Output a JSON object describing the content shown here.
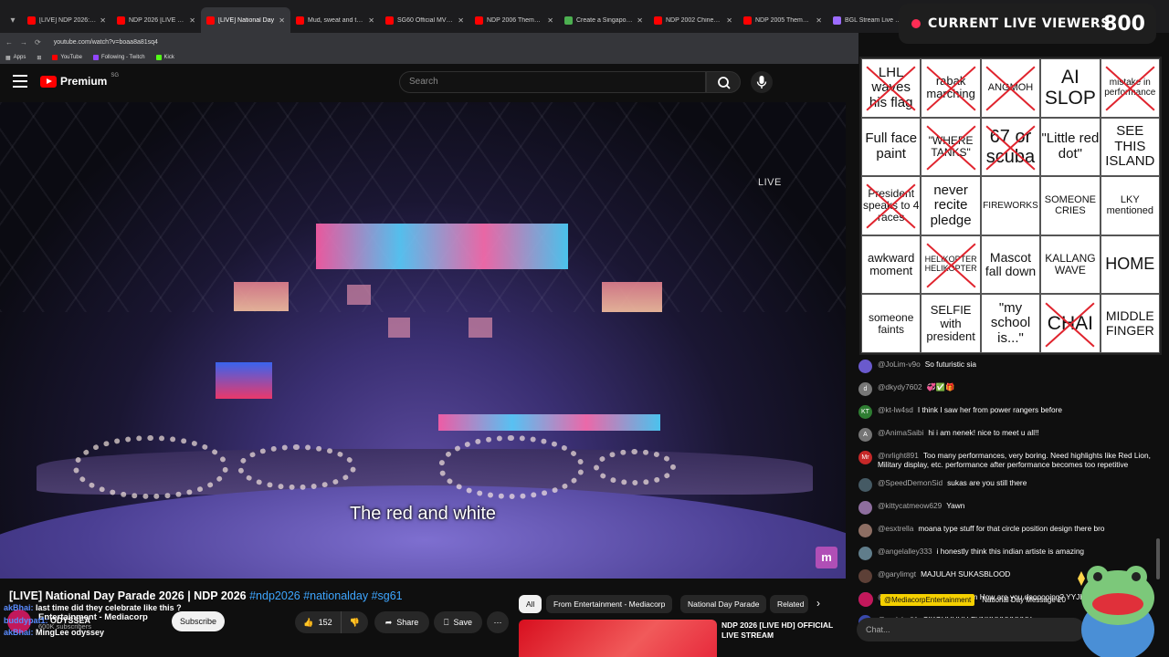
{
  "browser": {
    "tabs": [
      {
        "title": "[LIVE] NDP 2026: Singa",
        "active": false,
        "fav": "yt"
      },
      {
        "title": "NDP 2026 [LIVE HD] OF",
        "active": false,
        "fav": "yt"
      },
      {
        "title": "[LIVE] National Day",
        "active": true,
        "fav": "yt"
      },
      {
        "title": "Mud, sweat and tears",
        "active": false,
        "fav": "yt"
      },
      {
        "title": "SG60 Official MV (Koala",
        "active": false,
        "fav": "yt"
      },
      {
        "title": "NDP 2006 Theme Song",
        "active": false,
        "fav": "yt"
      },
      {
        "title": "Create a Singapore ND",
        "active": false,
        "fav": "doc"
      },
      {
        "title": "NDP 2002 Chinese The",
        "active": false,
        "fav": "yt"
      },
      {
        "title": "NDP 2005 Theme Song",
        "active": false,
        "fav": "yt"
      },
      {
        "title": "BGL Stream Live Views",
        "active": false,
        "fav": "alt"
      }
    ],
    "url": "youtube.com/watch?v=boaa8a81sq4",
    "bookmarks": [
      "Apps",
      "YouTube",
      "Following - Twitch",
      "Kick"
    ]
  },
  "youtube": {
    "logo_text": "Premium",
    "logo_country": "SG",
    "search_placeholder": "Search"
  },
  "video": {
    "live_label": "LIVE",
    "caption": "The red and white",
    "title_plain": "[LIVE] National Day Parade 2026 | NDP 2026 ",
    "hashtags": "#ndp2026 #nationalday #sg61",
    "channel_name": "Entertainment - Mediacorp",
    "subscribers": "600K subscribers",
    "subscribe_label": "Subscribe",
    "likes": "152",
    "share_label": "Share",
    "save_label": "Save"
  },
  "overlay_chat": [
    {
      "user": "akBhai:",
      "text": "last time did they celebrate like this ?"
    },
    {
      "user": "buddypat1:",
      "text": "ODYSSEA"
    },
    {
      "user": "akBhai:",
      "text": "MingLee odyssey"
    }
  ],
  "recommendations": {
    "chips": [
      "All",
      "From Entertainment - Mediacorp",
      "National Day Parade",
      "Related"
    ],
    "first_title": "NDP 2026 [LIVE HD] OFFICIAL LIVE STREAM"
  },
  "viewers": {
    "label": "CURRENT LIVE VIEWERS",
    "count": "800"
  },
  "bingo": [
    {
      "text": "LHL waves his flag",
      "crossed": true,
      "size": 15
    },
    {
      "text": "rabak marching",
      "crossed": true,
      "size": 13
    },
    {
      "text": "ANGMOH",
      "crossed": true,
      "size": 11
    },
    {
      "text": "AI SLOP",
      "crossed": false,
      "size": 21
    },
    {
      "text": "mistake in performance",
      "crossed": true,
      "size": 10
    },
    {
      "text": "Full face paint",
      "crossed": false,
      "size": 15
    },
    {
      "text": "\"WHERE TANKS\"",
      "crossed": true,
      "size": 12
    },
    {
      "text": "67 or scuba",
      "crossed": true,
      "size": 20
    },
    {
      "text": "\"Little red dot\"",
      "crossed": false,
      "size": 15
    },
    {
      "text": "SEE THIS ISLAND",
      "crossed": false,
      "size": 15
    },
    {
      "text": "President speaks to 4 races",
      "crossed": true,
      "size": 12
    },
    {
      "text": "never recite pledge",
      "crossed": false,
      "size": 15
    },
    {
      "text": "FIREWORKS",
      "crossed": false,
      "size": 10
    },
    {
      "text": "SOMEONE CRIES",
      "crossed": false,
      "size": 11
    },
    {
      "text": "LKY mentioned",
      "crossed": false,
      "size": 11
    },
    {
      "text": "awkward moment",
      "crossed": false,
      "size": 13
    },
    {
      "text": "HELIKOPTER HELIKOPTER",
      "crossed": true,
      "size": 9
    },
    {
      "text": "Mascot fall down",
      "crossed": false,
      "size": 14
    },
    {
      "text": "KALLANG WAVE",
      "crossed": false,
      "size": 12
    },
    {
      "text": "HOME",
      "crossed": false,
      "size": 18
    },
    {
      "text": "someone faints",
      "crossed": false,
      "size": 12
    },
    {
      "text": "SELFIE with president",
      "crossed": false,
      "size": 13
    },
    {
      "text": "\"my school is...\"",
      "crossed": false,
      "size": 15
    },
    {
      "text": "CHAI",
      "crossed": true,
      "size": 21
    },
    {
      "text": "MIDDLE FINGER",
      "crossed": false,
      "size": 14
    }
  ],
  "chat": [
    {
      "user": "@JoLim-v9o",
      "text": "So futuristic sia",
      "color": "#6a5acd",
      "initial": ""
    },
    {
      "user": "@dkydy7602",
      "text": "💞✅🎁",
      "color": "#777777",
      "initial": "d"
    },
    {
      "user": "@kt-lw4sd",
      "text": "I think I saw her from power rangers before",
      "color": "#2e7d32",
      "initial": "KT"
    },
    {
      "user": "@AnimaSaibi",
      "text": "hi i am nenek! nice to meet u all!!",
      "color": "#757575",
      "initial": "A"
    },
    {
      "user": "@nrlight891",
      "text": "Too many performances, very boring. Need highlights like Red Lion, Military display, etc. performance after performance becomes too repetitive",
      "color": "#c62828",
      "initial": "Mr"
    },
    {
      "user": "@SpeedDemonSid",
      "text": "sukas are you still there",
      "color": "#455a64",
      "initial": ""
    },
    {
      "user": "@kittycatmeow629",
      "text": "Yawn",
      "color": "#8e6e9e",
      "initial": ""
    },
    {
      "user": "@esxtrella",
      "text": "moana type stuff for that circle position design there bro",
      "color": "#8d6e63",
      "initial": ""
    },
    {
      "user": "@angelalley333",
      "text": "i honestly think this indian artiste is amazing",
      "color": "#607d8b",
      "initial": ""
    },
    {
      "user": "@garylimgt",
      "text": "MAJULAH SUKASBLOOD",
      "color": "#5d4037",
      "initial": ""
    },
    {
      "user": "@lilbearbear4133",
      "text": "@clairelim How are you doooooing? YYJHEART",
      "color": "#7b5fa0",
      "initial": "L"
    },
    {
      "user": "@malshq01",
      "text": "CIKGUUUUU FUNKYYYYYYYY",
      "color": "#3949ab",
      "initial": ""
    }
  ],
  "pinned": {
    "user": "@MediacorpEntertainment",
    "text": "National Day Message 20"
  },
  "chat_input_placeholder": "Chat..."
}
